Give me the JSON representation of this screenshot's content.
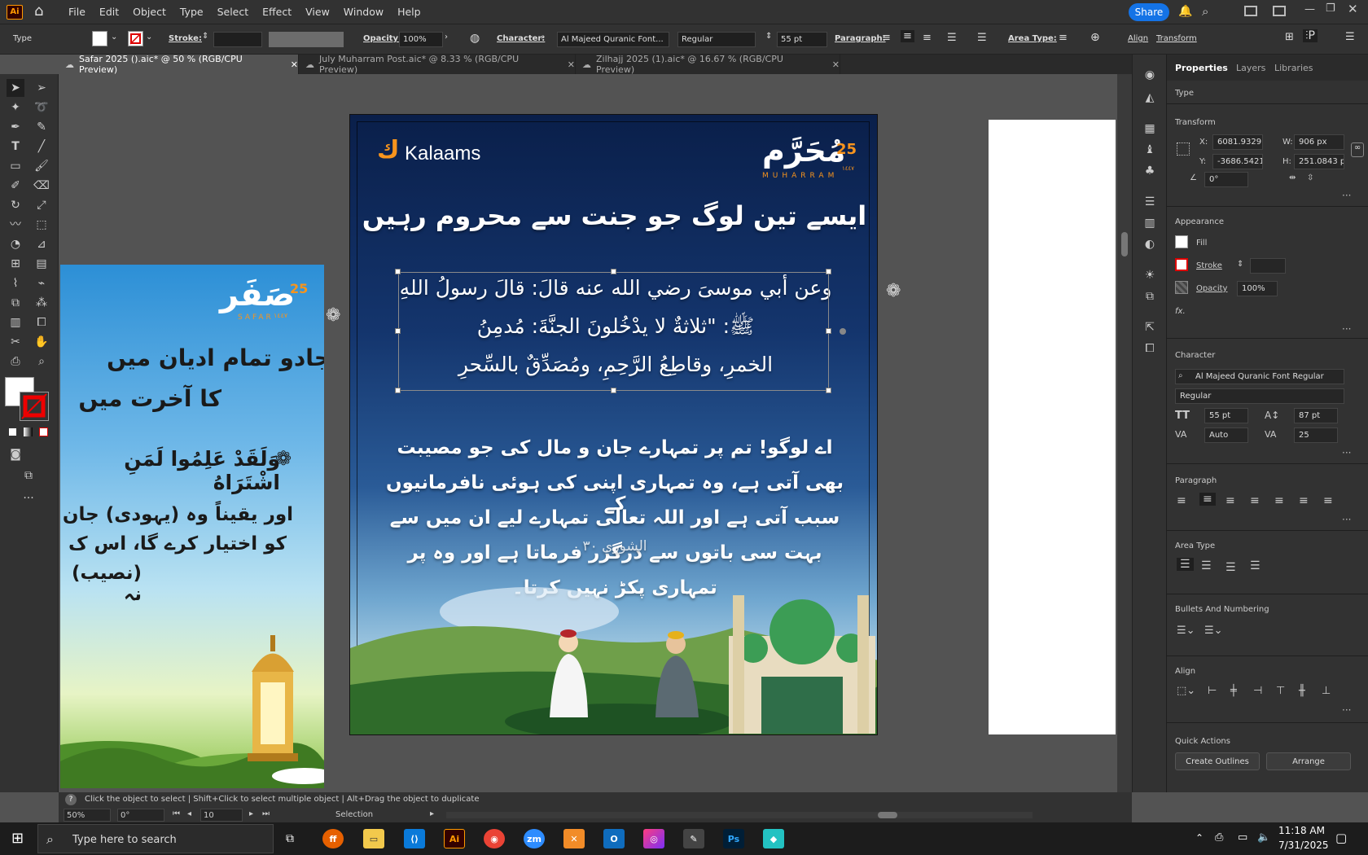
{
  "menubar": {
    "app_logo": "Ai",
    "items": [
      "File",
      "Edit",
      "Object",
      "Type",
      "Select",
      "Effect",
      "View",
      "Window",
      "Help"
    ],
    "share": "Share"
  },
  "control": {
    "type_label": "Type",
    "stroke_label": "Stroke:",
    "opacity_label": "Opacity:",
    "opacity_value": "100%",
    "character_label": "Character:",
    "font_name": "Al Majeed Quranic Font...",
    "font_style": "Regular",
    "font_size": "55 pt",
    "paragraph_label": "Paragraph:",
    "area_type_label": "Area Type:",
    "align_label": "Align",
    "transform_label": "Transform"
  },
  "tabs": [
    {
      "label": "Safar 2025 ().aic* @ 50 % (RGB/CPU Preview)"
    },
    {
      "label": "July Muharram Post.aic* @ 8.33 % (RGB/CPU Preview)"
    },
    {
      "label": "Zilhajj 2025 (1).aic* @ 16.67 % (RGB/CPU Preview)"
    }
  ],
  "artboard_main": {
    "brand": "Kalaams",
    "month_number": "25",
    "month_ar": "مُحَرَّم",
    "month_en": "MUHARRAM",
    "year_tag": "١٤٤٧",
    "heading": "ایسے تین لوگ جو جنت سے محروم رہیں",
    "arabic_lines": [
      "وعن أبي موسىَ رضي الله عنه قالَ: قالَ رسولُ اللهِ",
      "ﷺ: \"ثلاثةٌ لا يدْخُلونَ الجنَّةَ: مُدمِنُ",
      "الخمرِ، وقاطِعُ الرَّحِمِ، ومُصَدِّقٌ بالسِّحرِ"
    ],
    "urdu_lines": [
      "اے لوگو! تم پر تمہارے جان و مال کی جو مصیبت",
      "بھی آتی ہے، وہ تمہاری اپنی کی ہوئی نافرمانیوں کے",
      "سبب آتی ہے اور اللہ تعالی تمہارے لیے ان میں سے",
      "بہت سی باتوں سے درگزر فرماتا ہے اور وہ پر",
      "تمہاری پکڑ نہیں کرتا۔"
    ],
    "overlap_text": "الشوری ۳۰"
  },
  "artboard_left": {
    "month_number": "25",
    "month_ar": "صَفَر",
    "month_en": "SAFAR",
    "year_tag": "١٤٤٧",
    "line1": "جادو تمام ادیان میں",
    "line2": "کا آخرت میں",
    "ayah": "وَلَقَدْ عَلِمُوا لَمَنِ اشْتَرَاهُ",
    "trans1": "اور یقیناً وہ (یہودی) جان",
    "trans2": "کو اختیار کرے گا، اس ک",
    "trans3": "(نصیب) نہ"
  },
  "panel": {
    "tabs": [
      "Properties",
      "Layers",
      "Libraries"
    ],
    "type_label": "Type",
    "transform": {
      "title": "Transform",
      "x_label": "X:",
      "x": "6081.9329",
      "y_label": "Y:",
      "y": "-3686.5421",
      "w_label": "W:",
      "w": "906 px",
      "h_label": "H:",
      "h": "251.0843 p",
      "angle": "0°"
    },
    "appearance": {
      "title": "Appearance",
      "fill": "Fill",
      "stroke": "Stroke",
      "opacity": "Opacity",
      "opacity_value": "100%",
      "fx": "fx."
    },
    "character": {
      "title": "Character",
      "font": "Al Majeed Quranic Font Regular",
      "style": "Regular",
      "size": "55 pt",
      "leading": "87 pt",
      "kerning": "Auto",
      "tracking": "25"
    },
    "paragraph": {
      "title": "Paragraph"
    },
    "area_type": {
      "title": "Area Type"
    },
    "bullets": {
      "title": "Bullets And Numbering"
    },
    "align": {
      "title": "Align"
    },
    "quick_actions": {
      "title": "Quick Actions",
      "create_outlines": "Create Outlines",
      "arrange": "Arrange"
    }
  },
  "status": {
    "hint": "Click the object to select  |  Shift+Click to select multiple object  |  Alt+Drag the object to duplicate",
    "zoom": "50%",
    "rotation": "0°",
    "artboard_num": "10",
    "mode": "Selection"
  },
  "taskbar": {
    "search_placeholder": "Type here to search",
    "time": "11:18 AM",
    "date": "7/31/2025"
  },
  "colors": {
    "accent": "#1473e6",
    "chrome": "#323232",
    "canvas": "#535353",
    "orange": "#f7941d"
  }
}
